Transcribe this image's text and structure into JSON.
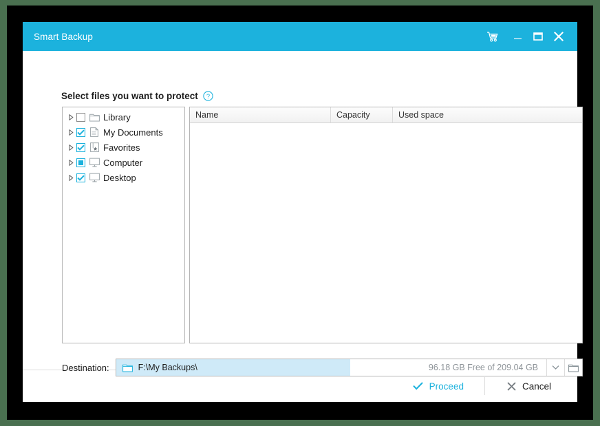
{
  "window": {
    "title": "Smart Backup",
    "controls": [
      {
        "name": "cart-icon",
        "label": "Cart"
      },
      {
        "name": "minimize-icon",
        "label": "Minimize"
      },
      {
        "name": "maximize-icon",
        "label": "Maximize"
      },
      {
        "name": "close-icon",
        "label": "Close"
      }
    ]
  },
  "colors": {
    "accent": "#1cb2dd",
    "titlebar": "#1cb2dd",
    "backdrop": "#4a7050",
    "frame": "#000000",
    "field_highlight": "#cfeaf8",
    "muted_text": "#8e9499"
  },
  "main": {
    "heading": "Select files you want to protect",
    "help_icon": "help-circle-icon"
  },
  "tree": {
    "items": [
      {
        "label": "Library",
        "checked": "unchecked",
        "icon": "folder-icon",
        "expanded": false
      },
      {
        "label": "My Documents",
        "checked": "checked",
        "icon": "document-icon",
        "expanded": false
      },
      {
        "label": "Favorites",
        "checked": "checked",
        "icon": "favorites-icon",
        "expanded": false
      },
      {
        "label": "Computer",
        "checked": "indeterminate",
        "icon": "monitor-icon",
        "expanded": false
      },
      {
        "label": "Desktop",
        "checked": "checked",
        "icon": "monitor-icon",
        "expanded": false
      }
    ]
  },
  "file_list": {
    "columns": [
      "Name",
      "Capacity",
      "Used space"
    ],
    "rows": []
  },
  "destination": {
    "label": "Destination:",
    "path": "F:\\My Backups\\",
    "folder_icon": "folder-icon",
    "free_space": "96.18 GB Free of 209.04 GB",
    "dropdown_icon": "chevron-down-icon",
    "browse_icon": "folder-browse-icon"
  },
  "footer": {
    "proceed": "Proceed",
    "cancel": "Cancel"
  }
}
